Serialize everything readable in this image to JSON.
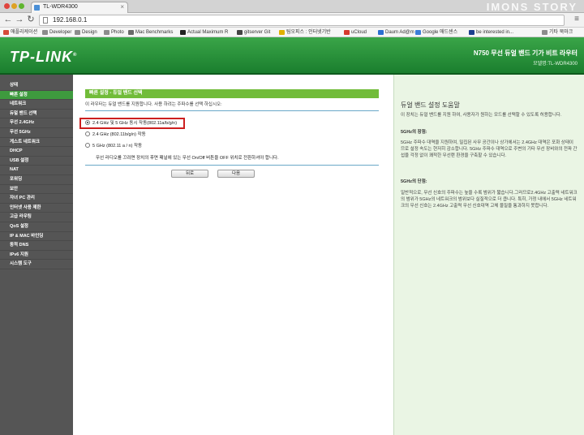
{
  "browser": {
    "tab_title": "TL-WDR4300",
    "url": "192.168.0.1",
    "watermark": "IMONS STORY",
    "bookmarks": [
      {
        "label": "애플리케이션",
        "color": "#d64a3a"
      },
      {
        "label": "Developer",
        "color": "#8c8c8c"
      },
      {
        "label": "Design",
        "color": "#8c8c8c"
      },
      {
        "label": "Photo",
        "color": "#8c8c8c"
      },
      {
        "label": "Mac Benchmarks",
        "color": "#6a6a6a"
      },
      {
        "label": "Actual Maximum R",
        "color": "#222222"
      },
      {
        "label": "gitserver Git",
        "color": "#444444"
      },
      {
        "label": "팀오피스 : 인터넷기반",
        "color": "#e0b000"
      },
      {
        "label": "uCloud",
        "color": "#d63a2e"
      },
      {
        "label": "Daum Ad@m",
        "color": "#2c6fd0"
      },
      {
        "label": "Google 애드센스",
        "color": "#3c7dd8"
      },
      {
        "label": "be interested in...",
        "color": "#1d3f8f"
      },
      {
        "label": "기타 북마크",
        "color": "#8c8c8c"
      }
    ]
  },
  "header": {
    "logo": "TP-LINK",
    "logo_mark": "®",
    "model_title": "N750 무선 듀얼 밴드 기가 비트 라우터",
    "model_number": "모델명:TL-WDR4300",
    "brand_color": "#2a9440"
  },
  "sidebar": {
    "active_index": 1,
    "items": [
      {
        "label": "상태"
      },
      {
        "label": "빠른 설정"
      },
      {
        "label": "네트워크"
      },
      {
        "label": "듀얼 밴드 선택"
      },
      {
        "label": "무선 2.4GHz"
      },
      {
        "label": "무선 5GHz"
      },
      {
        "label": "게스트 네트워크"
      },
      {
        "label": "DHCP"
      },
      {
        "label": "USB 설정"
      },
      {
        "label": "NAT"
      },
      {
        "label": "포워딩"
      },
      {
        "label": "보안"
      },
      {
        "label": "자녀 PC 관리"
      },
      {
        "label": "인터넷 사용 제한"
      },
      {
        "label": "고급 라우팅"
      },
      {
        "label": "QoS 설정"
      },
      {
        "label": "IP & MAC 바인딩"
      },
      {
        "label": "동적 DNS"
      },
      {
        "label": "IPv6 지원"
      },
      {
        "label": "시스템 도구"
      }
    ]
  },
  "main": {
    "section_title": "빠른 설정 - 듀얼 밴드 선택",
    "intro": "이 라우터는 듀얼 밴드를 지원합니다. 사용 하려는 주파수를 선택 하십시오:",
    "options": [
      {
        "label": "2.4 GHz 및 5 GHz 동시 작동(802.11a/b/g/n)",
        "checked": true
      },
      {
        "label": "2.4 GHz (802.11b/g/n) 작동",
        "checked": false
      },
      {
        "label": "5 GHz (802.11 a / n) 작동",
        "checked": false
      }
    ],
    "warning": "무선 라디오를 끄려면 장치의 후면 패널에 있는 무선 On/Off 버튼을 OFF 위치로 전환하셔야 합니다.",
    "back_label": "뒤로",
    "next_label": "다음"
  },
  "help": {
    "title": "듀얼 밴드 설정 도움말",
    "p1": "이 장치는 듀얼 밴드를 지원 하여, 사용자가 원하는 모드를 선택할 수 있도록 허용합니다.",
    "h_5g_pros": "5GHz의 장점:",
    "p_5g_pros": "5GHz 주파수 대역을 지원하여, 밀집된 사무 공간이나 상가에서는 2.4GHz 대역은 포화 상태이므로 설정 속도는 현저히 감소합니다. 5GHz 주파수 대역으로 주변의 기타 무선 장비와의 전파 간섭을 걱정 없이 쾌적한 무선랜 환경을 구축할 수 있습니다.",
    "h_5g_cons": "5GHz의 단점:",
    "p_5g_cons": "일반적으로, 무선 신호의 주파수는 높을 수록 범위가 짧습니다.그러므로2.4GHz 고출력 네트워크의 범위가 5GHz의 네트워크의 범위보다 실질적으로 더 큽니다. 특히, 가정 내에서 5GHz 네트워크의 무선 신호는 2.4GHz 고출력 무선 신호대역 고체 물질을 통과하지 못합니다."
  }
}
